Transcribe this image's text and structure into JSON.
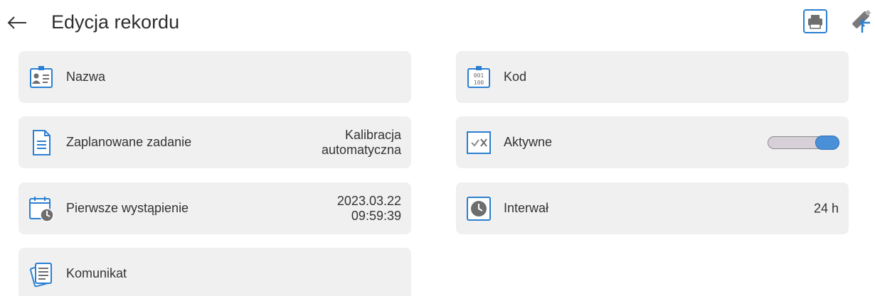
{
  "header": {
    "title": "Edycja rekordu"
  },
  "fields": {
    "nazwa": {
      "label": "Nazwa",
      "value": ""
    },
    "kod": {
      "label": "Kod",
      "value": ""
    },
    "zaplanowane_zadanie": {
      "label": "Zaplanowane zadanie",
      "value_line1": "Kalibracja",
      "value_line2": "automatyczna"
    },
    "aktywne": {
      "label": "Aktywne",
      "state": "on"
    },
    "pierwsze_wystapienie": {
      "label": "Pierwsze wystąpienie",
      "date": "2023.03.22",
      "time": "09:59:39"
    },
    "interwal": {
      "label": "Interwał",
      "value": "24 h"
    },
    "komunikat": {
      "label": "Komunikat",
      "value": ""
    }
  },
  "colors": {
    "card_bg": "#f0f0f0",
    "accent": "#4a90d9",
    "icon_blue": "#2b7fd0"
  }
}
